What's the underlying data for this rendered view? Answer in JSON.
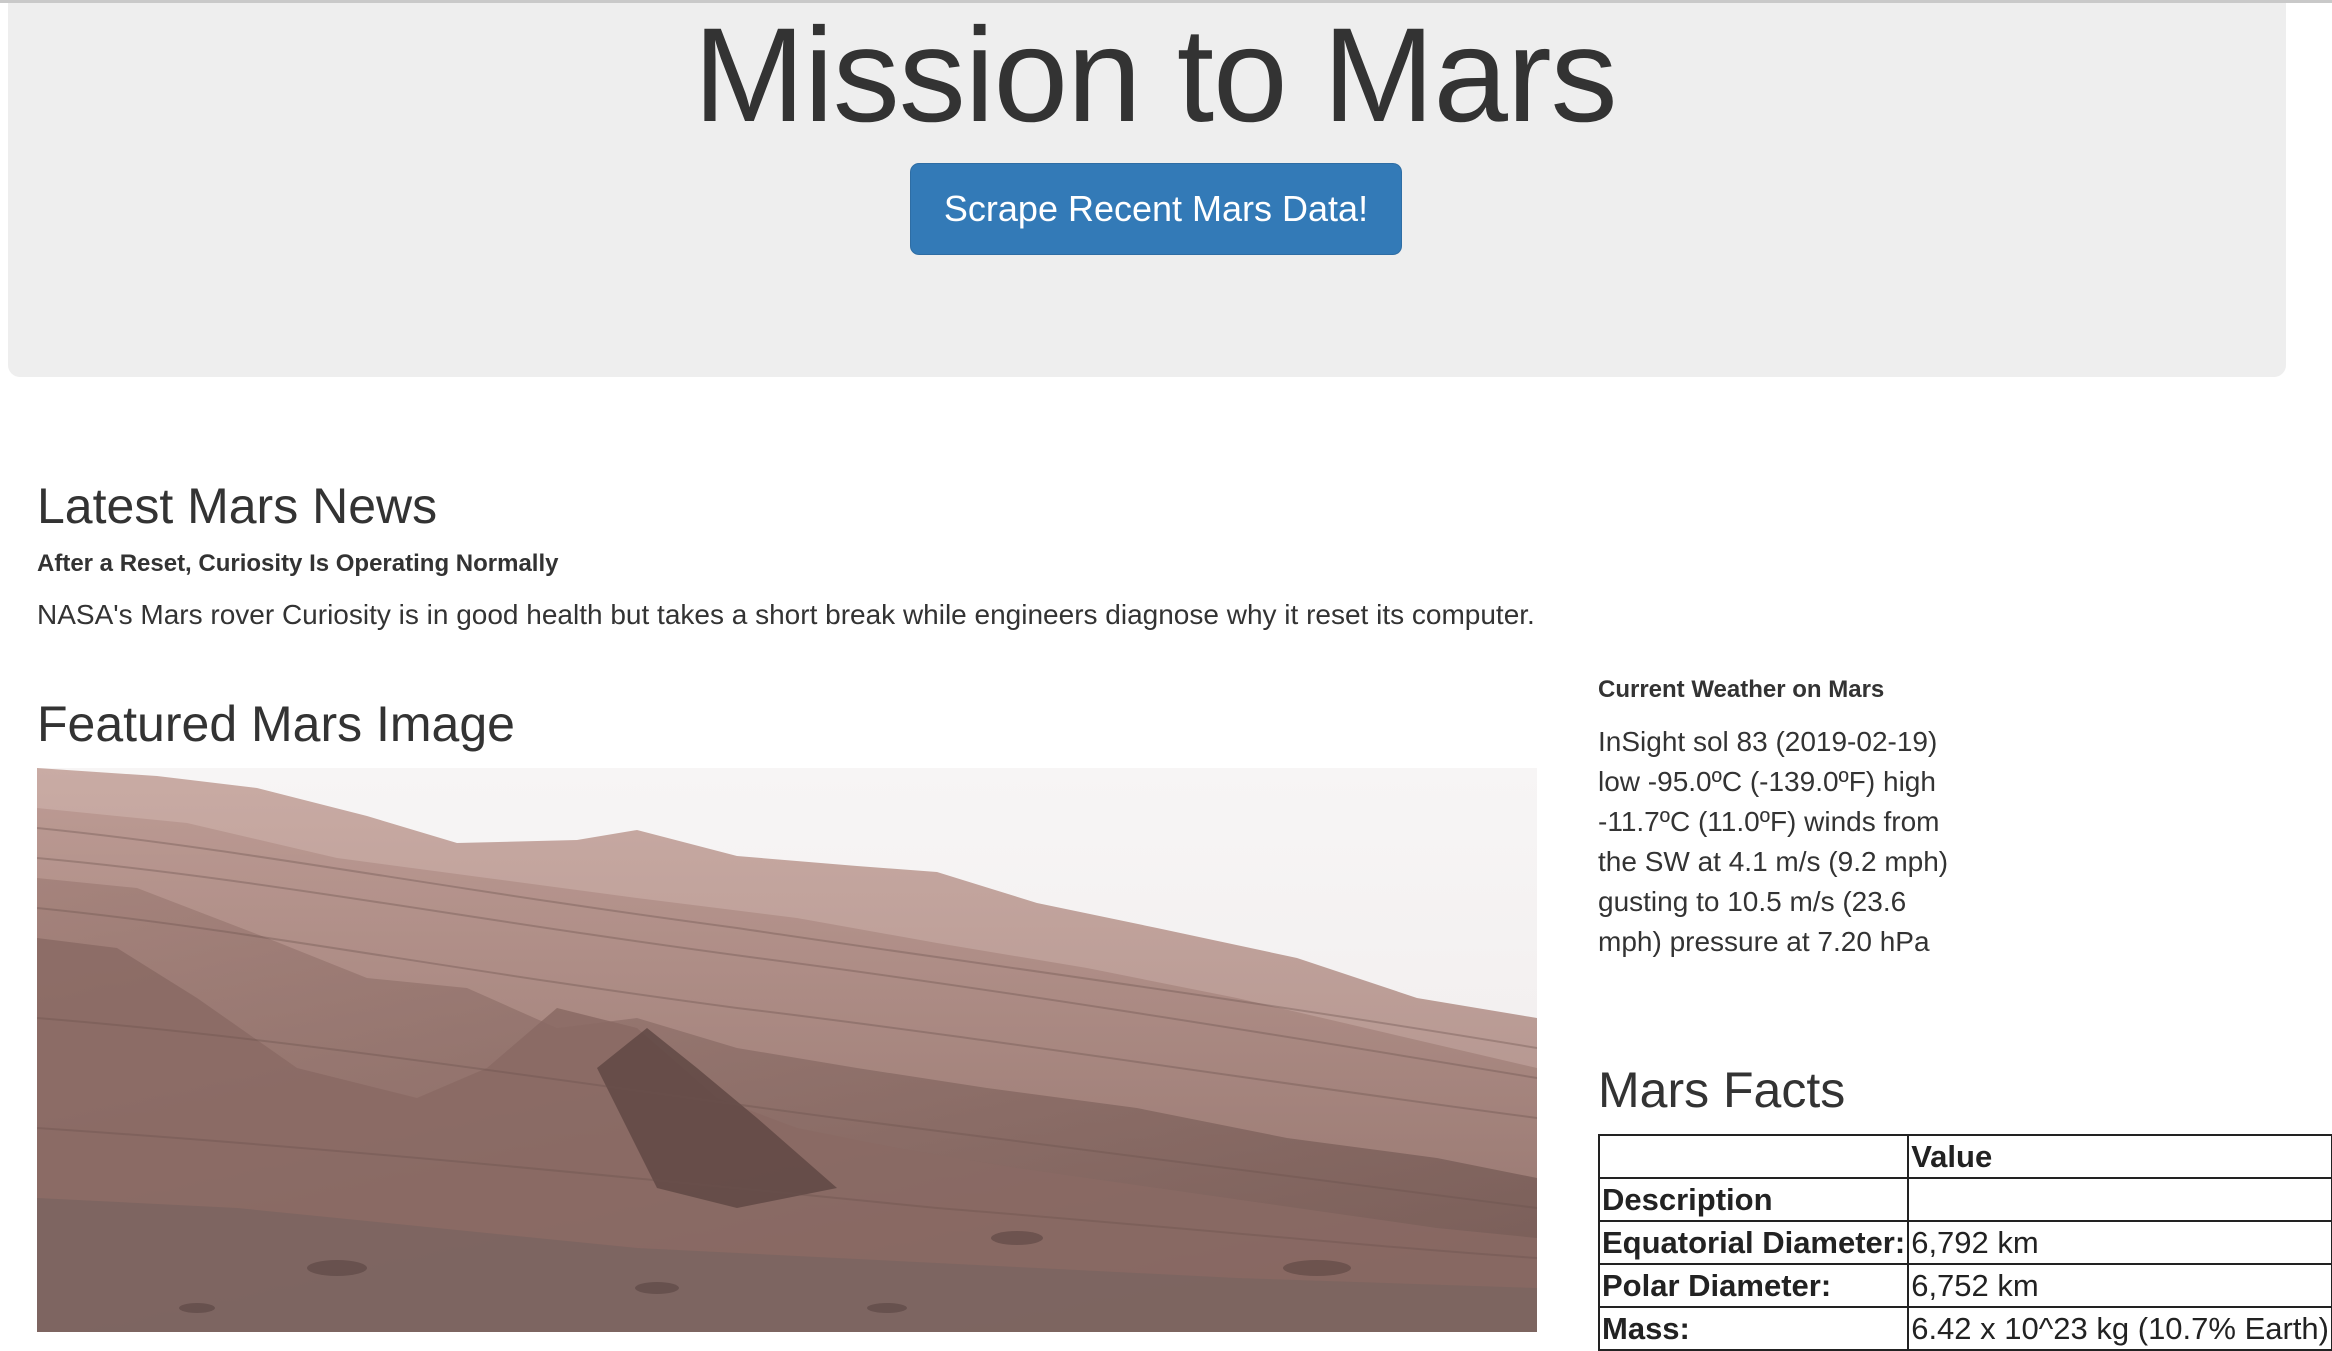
{
  "header": {
    "title": "Mission to Mars",
    "scrape_button_label": "Scrape Recent Mars Data!"
  },
  "news": {
    "heading": "Latest Mars News",
    "title": "After a Reset, Curiosity Is Operating Normally",
    "body": "NASA's Mars rover Curiosity is in good health but takes a short break while engineers diagnose why it reset its computer."
  },
  "featured": {
    "heading": "Featured Mars Image"
  },
  "weather": {
    "label": "Current Weather on Mars",
    "text": "InSight sol 83 (2019-02-19) low -95.0ºC (-139.0ºF) high -11.7ºC (11.0ºF) winds from the SW at 4.1 m/s (9.2 mph) gusting to 10.5 m/s (23.6 mph) pressure at 7.20 hPa"
  },
  "facts": {
    "heading": "Mars Facts",
    "header_blank": "",
    "header_value": "Value",
    "rows": [
      {
        "label": "Description",
        "value": ""
      },
      {
        "label": "Equatorial Diameter:",
        "value": "6,792 km"
      },
      {
        "label": "Polar Diameter:",
        "value": "6,752 km"
      },
      {
        "label": "Mass:",
        "value": "6.42 x 10^23 kg (10.7% Earth)"
      }
    ]
  },
  "colors": {
    "jumbotron_bg": "#eeeeee",
    "button_primary": "#337ab7",
    "text": "#333333"
  }
}
